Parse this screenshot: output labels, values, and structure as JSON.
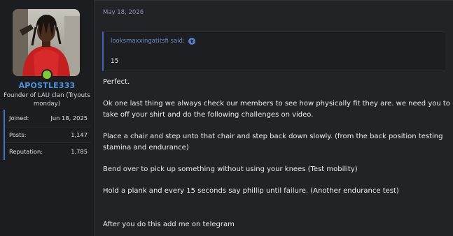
{
  "user": {
    "username": "APOSTLE333",
    "title": "Founder of LAU clan (Tryouts monday)",
    "avatar": "avatar-photo",
    "online_color": "#7fc836",
    "name_color": "#4d90e0"
  },
  "stats": [
    {
      "label": "Joined:",
      "value": "Jun 18, 2025"
    },
    {
      "label": "Posts:",
      "value": "1,147"
    },
    {
      "label": "Reputation:",
      "value": "1,785"
    }
  ],
  "post": {
    "date": "May 18, 2026",
    "quote": {
      "author": "looksmaxxingatitsfi said:",
      "icon": "arrow-up-circle-icon",
      "text": "15"
    },
    "lines": [
      "Perfect.",
      "Ok one last thing we always check our members to see how physically fit they are. we need you to",
      "take off your shirt and do the following challenges on video.",
      "Place a chair and step unto that chair and step back down slowly. (from the back position testing",
      "stamina and endurance)",
      "Bend over to pick up something without using your knees (Test mobility)",
      "Hold a plank and every 15 seconds say phillip until failure. (Another endurance test)",
      "After you do this add me on telegram"
    ]
  },
  "colors": {
    "background": "#222326",
    "sidebar": "#1c1d20",
    "accent": "#3f63b8"
  }
}
